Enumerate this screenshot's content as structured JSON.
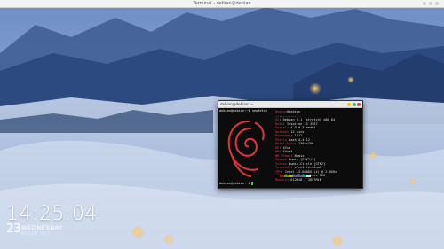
{
  "topbar": {
    "title": "Terminal - debian@debian"
  },
  "colors": {
    "terminal_bg": "#0c0c0c",
    "accent_red": "#d9343b",
    "prompt_green": "#39d353",
    "titlebar": "#e9e9e9"
  },
  "terminal": {
    "title": "debian@debian: ~",
    "prompt_top": "debian@debian:~$ neofetch",
    "prompt_bottom": "debian@debian:~$",
    "info": [
      {
        "key": "debian",
        "val": "@debian"
      },
      {
        "key": "",
        "val": "-------------"
      },
      {
        "key": "OS",
        "val": ": Debian 9.1 (stretch) x86_64"
      },
      {
        "key": "Host",
        "val": ": Inspiron 15 3567"
      },
      {
        "key": "Kernel",
        "val": ": 4.9.0-3-amd64"
      },
      {
        "key": "Uptime",
        "val": ": 12 mins"
      },
      {
        "key": "Packages",
        "val": ": 1811"
      },
      {
        "key": "Shell",
        "val": ": bash 4.4.12"
      },
      {
        "key": "Resolution",
        "val": ": 1366x768"
      },
      {
        "key": "DE",
        "val": ": Xfce"
      },
      {
        "key": "WM",
        "val": ": Xfwm4"
      },
      {
        "key": "WM Theme",
        "val": ": Numix"
      },
      {
        "key": "Theme",
        "val": ": Numix [GTK2/3]"
      },
      {
        "key": "Icons",
        "val": ": Numix-Circle [GTK2]"
      },
      {
        "key": "Terminal",
        "val": ": xfce4-terminal"
      },
      {
        "key": "CPU",
        "val": ": Intel i3-6006U (4) @ 2.0GHz"
      },
      {
        "key": "GPU",
        "val": ": Intel HD Graphics 520"
      },
      {
        "key": "Memory",
        "val": ": 612MiB / 3857MiB"
      }
    ],
    "palette": [
      "#000000",
      "#cc0000",
      "#4e9a06",
      "#c4a000",
      "#3465a4",
      "#75507b",
      "#06989a",
      "#d3d7cf"
    ]
  },
  "clock": {
    "time": "14:25:04",
    "day": "23",
    "weekday": "WEDNESDAY",
    "month_year": "AUGUST 2017"
  }
}
